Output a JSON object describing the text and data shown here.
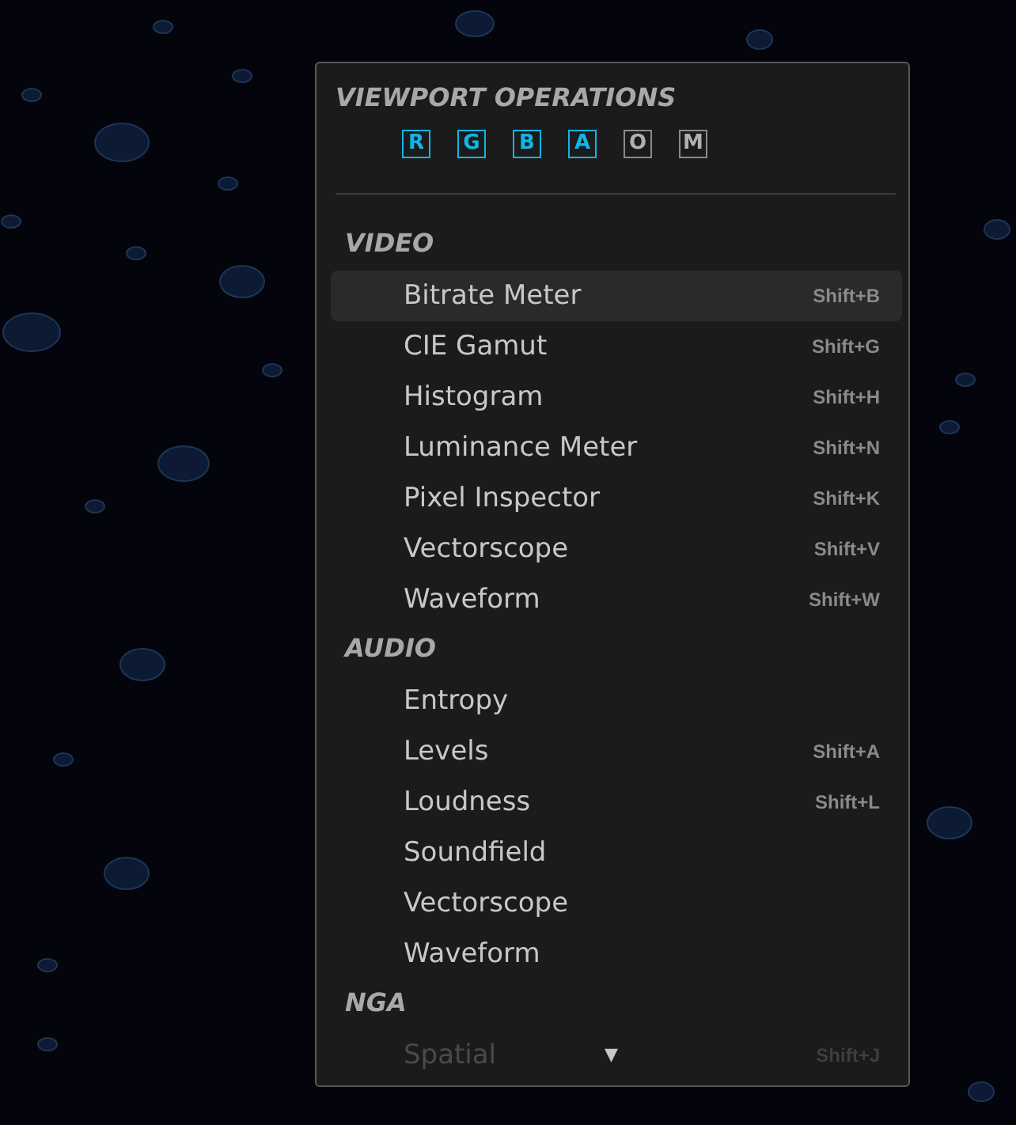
{
  "menu": {
    "title": "VIEWPORT OPERATIONS",
    "channels": [
      {
        "label": "R",
        "selected": true
      },
      {
        "label": "G",
        "selected": true
      },
      {
        "label": "B",
        "selected": true
      },
      {
        "label": "A",
        "selected": true
      },
      {
        "label": "O",
        "selected": false
      },
      {
        "label": "M",
        "selected": false
      }
    ],
    "sections": [
      {
        "title": "VIDEO",
        "items": [
          {
            "label": "Bitrate Meter",
            "shortcut": "Shift+B",
            "selected": true,
            "disabled": false
          },
          {
            "label": "CIE Gamut",
            "shortcut": "Shift+G",
            "selected": false,
            "disabled": false
          },
          {
            "label": "Histogram",
            "shortcut": "Shift+H",
            "selected": false,
            "disabled": false
          },
          {
            "label": "Luminance Meter",
            "shortcut": "Shift+N",
            "selected": false,
            "disabled": false
          },
          {
            "label": "Pixel Inspector",
            "shortcut": "Shift+K",
            "selected": false,
            "disabled": false
          },
          {
            "label": "Vectorscope",
            "shortcut": "Shift+V",
            "selected": false,
            "disabled": false
          },
          {
            "label": "Waveform",
            "shortcut": "Shift+W",
            "selected": false,
            "disabled": false
          }
        ]
      },
      {
        "title": "AUDIO",
        "items": [
          {
            "label": "Entropy",
            "selected": false,
            "disabled": false
          },
          {
            "label": "Levels",
            "shortcut": "Shift+A",
            "selected": false,
            "disabled": false
          },
          {
            "label": "Loudness",
            "shortcut": "Shift+L",
            "selected": false,
            "disabled": false
          },
          {
            "label": "Soundfield",
            "selected": false,
            "disabled": false
          },
          {
            "label": "Vectorscope",
            "selected": false,
            "disabled": false
          },
          {
            "label": "Waveform",
            "selected": false,
            "disabled": false
          }
        ]
      },
      {
        "title": "NGA",
        "items": [
          {
            "label": "Spatial",
            "shortcut": "Shift+J",
            "selected": false,
            "disabled": true
          }
        ]
      }
    ],
    "scroll_arrow": "▼"
  }
}
